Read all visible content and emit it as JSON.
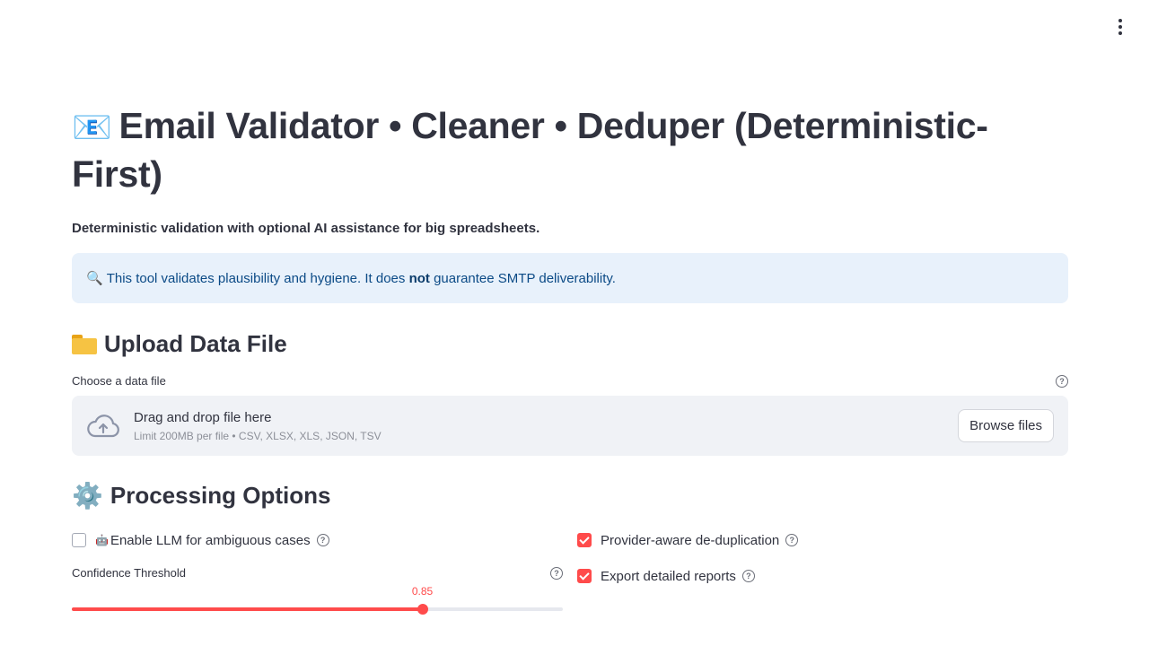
{
  "header": {
    "title": "Email Validator • Cleaner • Deduper (Deterministic-First)",
    "title_icon": "email-envelope-icon",
    "subtitle": "Deterministic validation with optional AI assistance for big spreadsheets."
  },
  "info": {
    "before": "This tool validates plausibility and hygiene. It does ",
    "bold": "not",
    "after": " guarantee SMTP deliverability.",
    "icon": "magnifier-icon",
    "color": "#0b4a86",
    "background": "#e8f1fb"
  },
  "upload": {
    "heading": "Upload Data File",
    "label": "Choose a data file",
    "drop_title": "Drag and drop file here",
    "limit": "Limit 200MB per file • CSV, XLSX, XLS, JSON, TSV",
    "browse_label": "Browse files"
  },
  "options": {
    "heading": "Processing Options",
    "llm_label": "Enable LLM for ambiguous cases",
    "llm_checked": false,
    "dedupe_label": "Provider-aware de-duplication",
    "dedupe_checked": true,
    "export_label": "Export detailed reports",
    "export_checked": true,
    "threshold_label": "Confidence Threshold",
    "threshold_value": "0.85",
    "threshold_fraction": 0.714
  },
  "colors": {
    "accent": "#ff4b4b",
    "text": "#31333f"
  }
}
